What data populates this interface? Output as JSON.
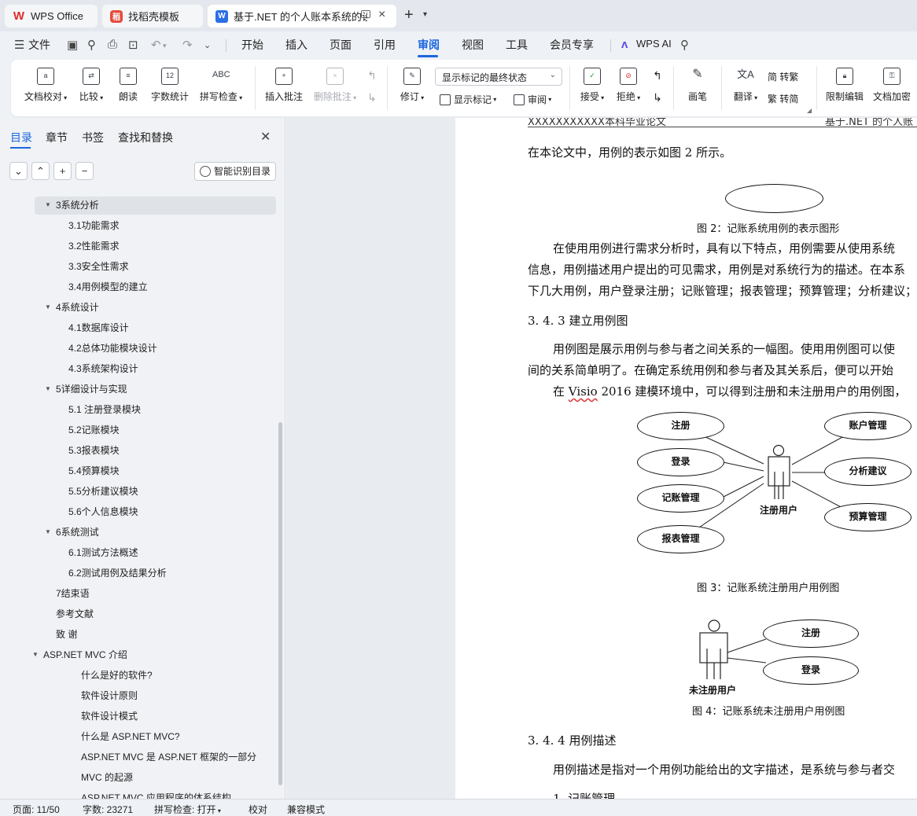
{
  "tabs": {
    "wps_label": "WPS Office",
    "daoke_label": "找稻壳模板",
    "doc_label": "基于.NET 的个人账本系统的设"
  },
  "menu": {
    "file": "文件",
    "items": [
      "开始",
      "插入",
      "页面",
      "引用",
      "审阅",
      "视图",
      "工具",
      "会员专享"
    ],
    "active": "审阅",
    "wps_ai": "WPS AI"
  },
  "ribbon": {
    "doc_check": "文档校对",
    "compare": "比较",
    "read_aloud": "朗读",
    "word_count": "字数统计",
    "spell_check": "拼写检查",
    "insert_comment": "插入批注",
    "delete_comment": "删除批注",
    "revise": "修订",
    "markup_state": "显示标记的最终状态",
    "show_markup": "显示标记",
    "review": "审阅",
    "accept": "接受",
    "reject": "拒绝",
    "pen": "画笔",
    "translate": "翻译",
    "to_traditional": "简 转繁",
    "to_simplified": "繁 转简",
    "restrict_edit": "限制编辑",
    "doc_encrypt": "文档加密",
    "wordcount_icon_text": "12",
    "spell_icon_text": "ABC"
  },
  "nav": {
    "tabs": [
      "目录",
      "章节",
      "书签",
      "查找和替换"
    ],
    "smart_toc": "智能识别目录",
    "toc": [
      {
        "label": "3系统分析",
        "level": 1,
        "expanded": true,
        "selected": true
      },
      {
        "label": "3.1功能需求",
        "level": 2
      },
      {
        "label": "3.2性能需求",
        "level": 2
      },
      {
        "label": "3.3安全性需求",
        "level": 2
      },
      {
        "label": "3.4用例模型的建立",
        "level": 2
      },
      {
        "label": "4系统设计",
        "level": 1,
        "expanded": true
      },
      {
        "label": "4.1数据库设计",
        "level": 2
      },
      {
        "label": "4.2总体功能模块设计",
        "level": 2
      },
      {
        "label": "4.3系统架构设计",
        "level": 2
      },
      {
        "label": "5详细设计与实现",
        "level": 1,
        "expanded": true
      },
      {
        "label": "5.1 注册登录模块",
        "level": 2
      },
      {
        "label": "5.2记账模块",
        "level": 2
      },
      {
        "label": "5.3报表模块",
        "level": 2
      },
      {
        "label": "5.4预算模块",
        "level": 2
      },
      {
        "label": "5.5分析建议模块",
        "level": 2
      },
      {
        "label": "5.6个人信息模块",
        "level": 2
      },
      {
        "label": "6系统测试",
        "level": 1,
        "expanded": true
      },
      {
        "label": "6.1测试方法概述",
        "level": 2
      },
      {
        "label": "6.2测试用例及结果分析",
        "level": 2
      },
      {
        "label": "7结束语",
        "level": 1
      },
      {
        "label": "参考文献",
        "level": 1
      },
      {
        "label": "致 谢",
        "level": 1
      },
      {
        "label": "ASP.NET MVC 介绍",
        "level": 0,
        "expanded": true
      },
      {
        "label": "什么是好的软件?",
        "level": 3
      },
      {
        "label": "软件设计原则",
        "level": 3
      },
      {
        "label": "软件设计模式",
        "level": 3
      },
      {
        "label": "什么是 ASP.NET MVC?",
        "level": 3
      },
      {
        "label": "ASP.NET MVC 是 ASP.NET 框架的一部分",
        "level": 3
      },
      {
        "label": "MVC 的起源",
        "level": 3
      },
      {
        "label": "ASP.NET MVC 应用程序的体系结构",
        "level": 3
      }
    ]
  },
  "document": {
    "header_left": "XXXXXXXXXXX本科毕业论文",
    "header_right": "基于.NET 的个人账",
    "p1": "在本论文中，用例的表示如图 2 所示。",
    "fig2_caption": "图 2：记账系统用例的表示图形",
    "p2_line1": "在使用用例进行需求分析时，具有以下特点，用例需要从使用系统",
    "p2_line2": "信息，用例描述用户提出的可见需求，用例是对系统行为的描述。在本系",
    "p2_line3": "下几大用例，用户登录注册；记账管理；报表管理；预算管理；分析建议；",
    "h343": "3. 4. 3  建立用例图",
    "p3_line1": "用例图是展示用例与参与者之间关系的一幅图。使用用例图可以使",
    "p3_line2": "间的关系简单明了。在确定系统用例和参与者及其关系后，便可以开始",
    "p4_pre": "在 ",
    "p4_visio": "Visio",
    "p4_post": " 2016 建模环境中，可以得到注册和未注册用户的用例图，",
    "fig3": {
      "left_cases": [
        "注册",
        "登录",
        "记账管理",
        "报表管理"
      ],
      "right_cases": [
        "账户管理",
        "分析建议",
        "预算管理"
      ],
      "actor": "注册用户",
      "caption": "图 3：记账系统注册用户用例图"
    },
    "fig4": {
      "cases": [
        "注册",
        "登录"
      ],
      "actor": "未注册用户",
      "caption": "图 4：记账系统未注册用户用例图"
    },
    "h344": "3. 4. 4  用例描述",
    "p5": "用例描述是指对一个用例功能给出的文字描述，是系统与参与者交",
    "p6": "1. 记账管理"
  },
  "status": {
    "page": "页面: 11/50",
    "words": "字数: 23271",
    "spell": "拼写检查: 打开",
    "proof": "校对",
    "compat": "兼容模式"
  }
}
